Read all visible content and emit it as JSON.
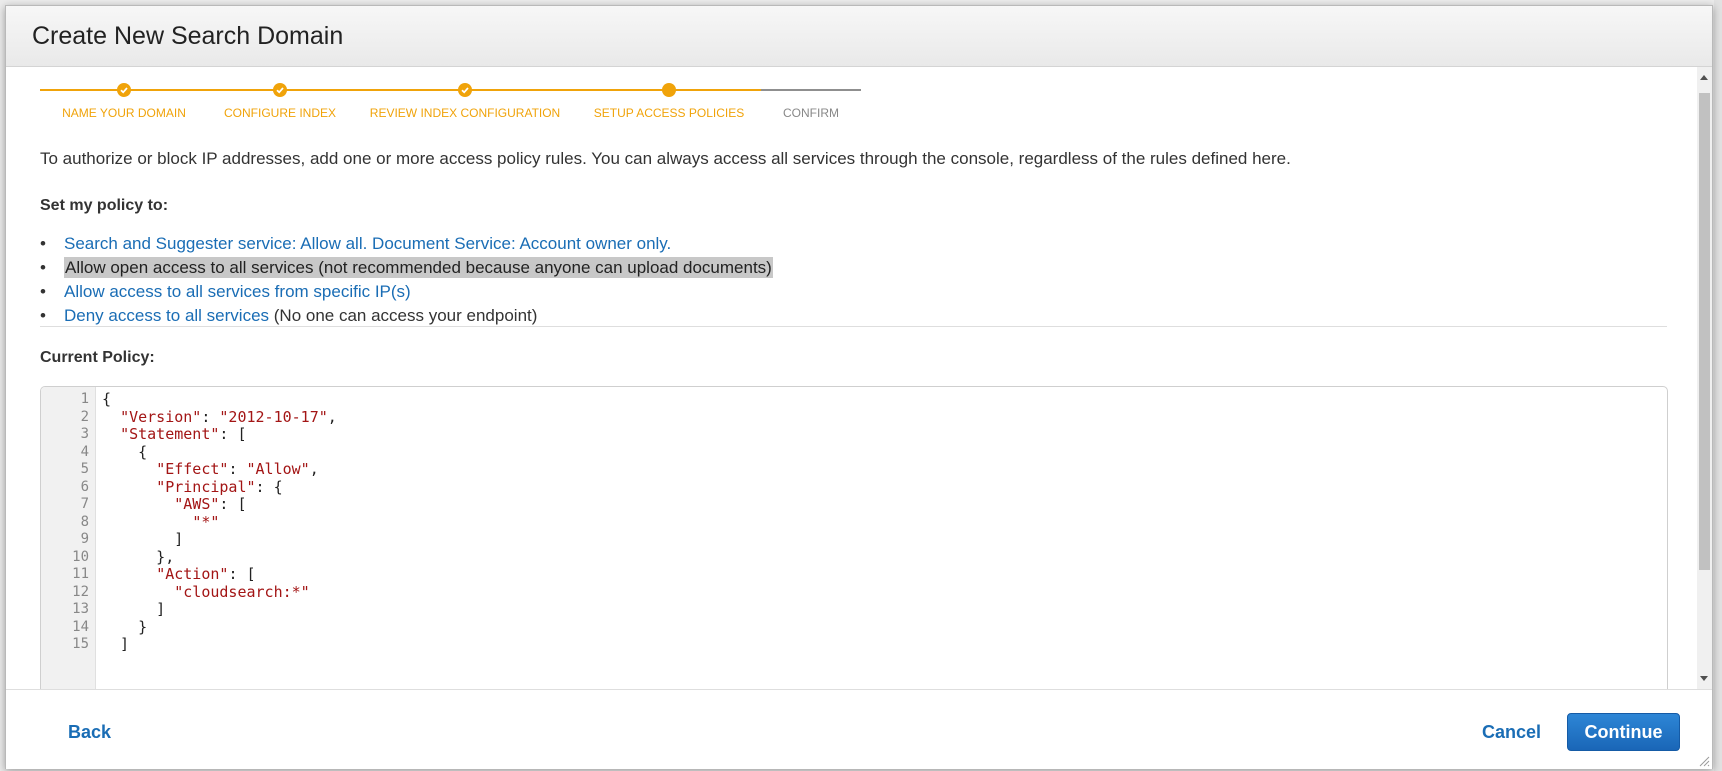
{
  "dialog": {
    "title": "Create New Search Domain"
  },
  "stepper": {
    "steps": [
      {
        "label": "NAME YOUR DOMAIN",
        "state": "completed"
      },
      {
        "label": "CONFIGURE INDEX",
        "state": "completed"
      },
      {
        "label": "REVIEW INDEX CONFIGURATION",
        "state": "completed"
      },
      {
        "label": "SETUP ACCESS POLICIES",
        "state": "current"
      },
      {
        "label": "CONFIRM",
        "state": "pending"
      }
    ],
    "active_color": "#f0a30a",
    "inactive_color": "#888888"
  },
  "intro_text": "To authorize or block IP addresses, add one or more access policy rules. You can always access all services through the console, regardless of the rules defined here.",
  "policy": {
    "heading": "Set my policy to:",
    "options": [
      {
        "label": "Search and Suggester service: Allow all. Document Service: Account owner only.",
        "suffix": ""
      },
      {
        "label": "Allow open access to all services (not recommended because anyone can upload documents)",
        "suffix": ""
      },
      {
        "label": "Allow access to all services from specific IP(s)",
        "suffix": ""
      },
      {
        "label": "Deny access to all services",
        "suffix": " (No one can access your endpoint)"
      }
    ],
    "selected_index": 1
  },
  "current_policy": {
    "heading": "Current Policy:",
    "line_numbers": [
      "1",
      "2",
      "3",
      "4",
      "5",
      "6",
      "7",
      "8",
      "9",
      "10",
      "11",
      "12",
      "13",
      "14",
      "15"
    ],
    "code_lines": [
      "{",
      "  \"Version\": \"2012-10-17\",",
      "  \"Statement\": [",
      "    {",
      "      \"Effect\": \"Allow\",",
      "      \"Principal\": {",
      "        \"AWS\": [",
      "          \"*\"",
      "        ]",
      "      },",
      "      \"Action\": [",
      "        \"cloudsearch:*\"",
      "      ]",
      "    }",
      "  ]"
    ]
  },
  "footer": {
    "back_label": "Back",
    "cancel_label": "Cancel",
    "continue_label": "Continue"
  },
  "colors": {
    "link": "#1a6db5",
    "primary_button": "#1a66b7",
    "json_string": "#a31515"
  }
}
